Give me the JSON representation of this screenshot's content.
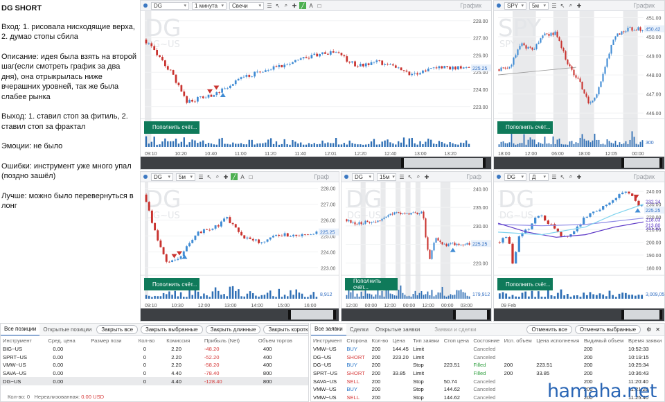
{
  "notes": {
    "title": "DG SHORT",
    "entry": "Вход: 1. рисовала нисходящие верха, 2. думао стопы сбила",
    "description": "Описание: идея была взять на второй шаг(если смотреть график за два дня), она отрыкрылась ниже вчерашних уровней, так же была слабее рынка",
    "exit": "Выход: 1. ставил стоп за фитиль, 2. ставил стоп за фрактал",
    "emotions": "Эмоции: не было",
    "mistakes": "Ошибки: инструмент уже много упал (поздно зашёл)",
    "better": "Лучше: можно было перевернуться в лонг"
  },
  "fund_label": "Пополнить счёт...",
  "panels": [
    {
      "symbol": "DG",
      "interval": "1 минута",
      "style": "Свечи",
      "graph": "График",
      "watermark": "DG",
      "sub": "DG~US",
      "price_badge": "225.25",
      "yticks": [
        "228.00",
        "227.00",
        "226.00",
        "225.00",
        "224.00",
        "223.00"
      ],
      "xticks": [
        "09:10",
        "10:20",
        "10:40",
        "11:00",
        "11:20",
        "11:40",
        "12:01",
        "12:20",
        "12:40",
        "13:00",
        "13:20"
      ],
      "ylim": [
        222.4,
        228.4
      ]
    },
    {
      "symbol": "SPY",
      "interval": "5м",
      "style": "",
      "graph": "График",
      "watermark": "SPY",
      "sub": "SPY~US",
      "price_badge": "450.42",
      "vol_badge": "300",
      "yticks": [
        "451.00",
        "450.00",
        "449.00",
        "448.00",
        "447.00",
        "446.00"
      ],
      "xticks": [
        "18:00",
        "12:00",
        "06:00",
        "18:00",
        "12:05",
        "00:00"
      ],
      "ylim": [
        445.8,
        451.2
      ]
    },
    {
      "symbol": "DG",
      "interval": "5м",
      "style": "",
      "graph": "Граф",
      "watermark": "DG",
      "sub": "DG~US",
      "price_badge": "225.25",
      "vol_badge": "8,912",
      "yticks": [
        "228.00",
        "227.00",
        "226.00",
        "225.00",
        "224.00",
        "223.00"
      ],
      "xticks": [
        "09:10",
        "10:30",
        "12:00",
        "13:00",
        "14:00",
        "15:00",
        "16:00"
      ],
      "ylim": [
        222.6,
        228.2
      ]
    },
    {
      "symbol": "DG",
      "interval": "15м",
      "style": "",
      "graph": "Граф",
      "watermark": "DG",
      "sub": "DG~US",
      "price_badge": "225.25",
      "vol_badge": "179,912",
      "yticks": [
        "240.00",
        "235.00",
        "230.00",
        "225.00",
        "220.00"
      ],
      "xticks": [
        "12:00",
        "00:00",
        "12:00",
        "00:00",
        "12:00",
        "00:00",
        "03:00"
      ],
      "ylim": [
        217,
        241
      ]
    },
    {
      "symbol": "DG",
      "interval": "Д",
      "style": "",
      "graph": "График",
      "watermark": "DG",
      "sub": "DG~US",
      "price_badge": "225.25",
      "badges": [
        "232.24",
        "218.03",
        "213.80",
        "211.32"
      ],
      "vol_badge": "3,009,056",
      "yticks": [
        "240.00",
        "230.00",
        "220.00",
        "210.00",
        "200.00",
        "190.00",
        "180.00"
      ],
      "xticks": [
        "09 Feb"
      ],
      "ylim": [
        175,
        245
      ]
    }
  ],
  "positions": {
    "tabs": [
      "Все позиции",
      "Открытые позиции"
    ],
    "buttons": [
      "Закрыть все",
      "Закрыть выбранные",
      "Закрыть длинные",
      "Закрыть короткие"
    ],
    "columns": [
      "Инструмент",
      "Сред. цена",
      "Размер пози",
      "Кол-во",
      "Комиссия",
      "Прибыль (Net)",
      "Объем торгов"
    ],
    "rows": [
      [
        "BIG~US",
        "0.00",
        "",
        "0",
        "2.20",
        "-48.20",
        "400"
      ],
      [
        "SPRT~US",
        "0.00",
        "",
        "0",
        "2.20",
        "-52.20",
        "400"
      ],
      [
        "VMW~US",
        "0.00",
        "",
        "0",
        "2.20",
        "-58.20",
        "400"
      ],
      [
        "SAVA~US",
        "0.00",
        "",
        "0",
        "4.40",
        "-78.40",
        "800"
      ],
      [
        "DG~US",
        "0.00",
        "",
        "0",
        "4.40",
        "-128.40",
        "800"
      ]
    ],
    "summary_label": "Кол-во: 0",
    "unrealized_label": "Нереализованная:",
    "unrealized_value": "0.00 USD"
  },
  "orders": {
    "tabs": [
      "Все заявки",
      "Сделки",
      "Открытые заявки"
    ],
    "title": "Заявки и сделки",
    "buttons": [
      "Отменить все",
      "Отменить выбранные"
    ],
    "columns": [
      "Инструмент",
      "Сторона",
      "Кол-во",
      "Цена",
      "Тип заявки",
      "Стоп цена",
      "Состояние",
      "Исп. объем",
      "Цена исполнения",
      "Видимый объем",
      "Время заявки"
    ],
    "rows": [
      [
        "VMW~US",
        "BUY",
        "200",
        "144.45",
        "Limit",
        "",
        "Canceled",
        "",
        "",
        "200",
        "10:52:33"
      ],
      [
        "DG~US",
        "SHORT",
        "200",
        "223.20",
        "Limit",
        "",
        "Canceled",
        "",
        "",
        "200",
        "10:19:15"
      ],
      [
        "DG~US",
        "BUY",
        "200",
        "",
        "Stop",
        "223.51",
        "Filled",
        "200",
        "223.51",
        "200",
        "10:25:34"
      ],
      [
        "SPRT~US",
        "SHORT",
        "200",
        "33.85",
        "Limit",
        "",
        "Filled",
        "200",
        "33.85",
        "200",
        "10:36:43"
      ],
      [
        "SAVA~US",
        "SELL",
        "200",
        "",
        "Stop",
        "50.74",
        "Canceled",
        "",
        "",
        "200",
        "11:20:40"
      ],
      [
        "VMW~US",
        "BUY",
        "200",
        "",
        "Stop",
        "144.62",
        "Canceled",
        "",
        "",
        "200",
        "11:21:20"
      ],
      [
        "VMW~US",
        "SELL",
        "200",
        "",
        "Stop",
        "144.62",
        "Canceled",
        "",
        "",
        "200",
        "11:25:40"
      ]
    ]
  },
  "watermark": "hamaha.net",
  "colors": {
    "up": "#3f8bd4",
    "down": "#c9332f",
    "volume": "#2f6fb5",
    "fund_button": "#0f7a5a",
    "accent": "#2d6bc1"
  }
}
